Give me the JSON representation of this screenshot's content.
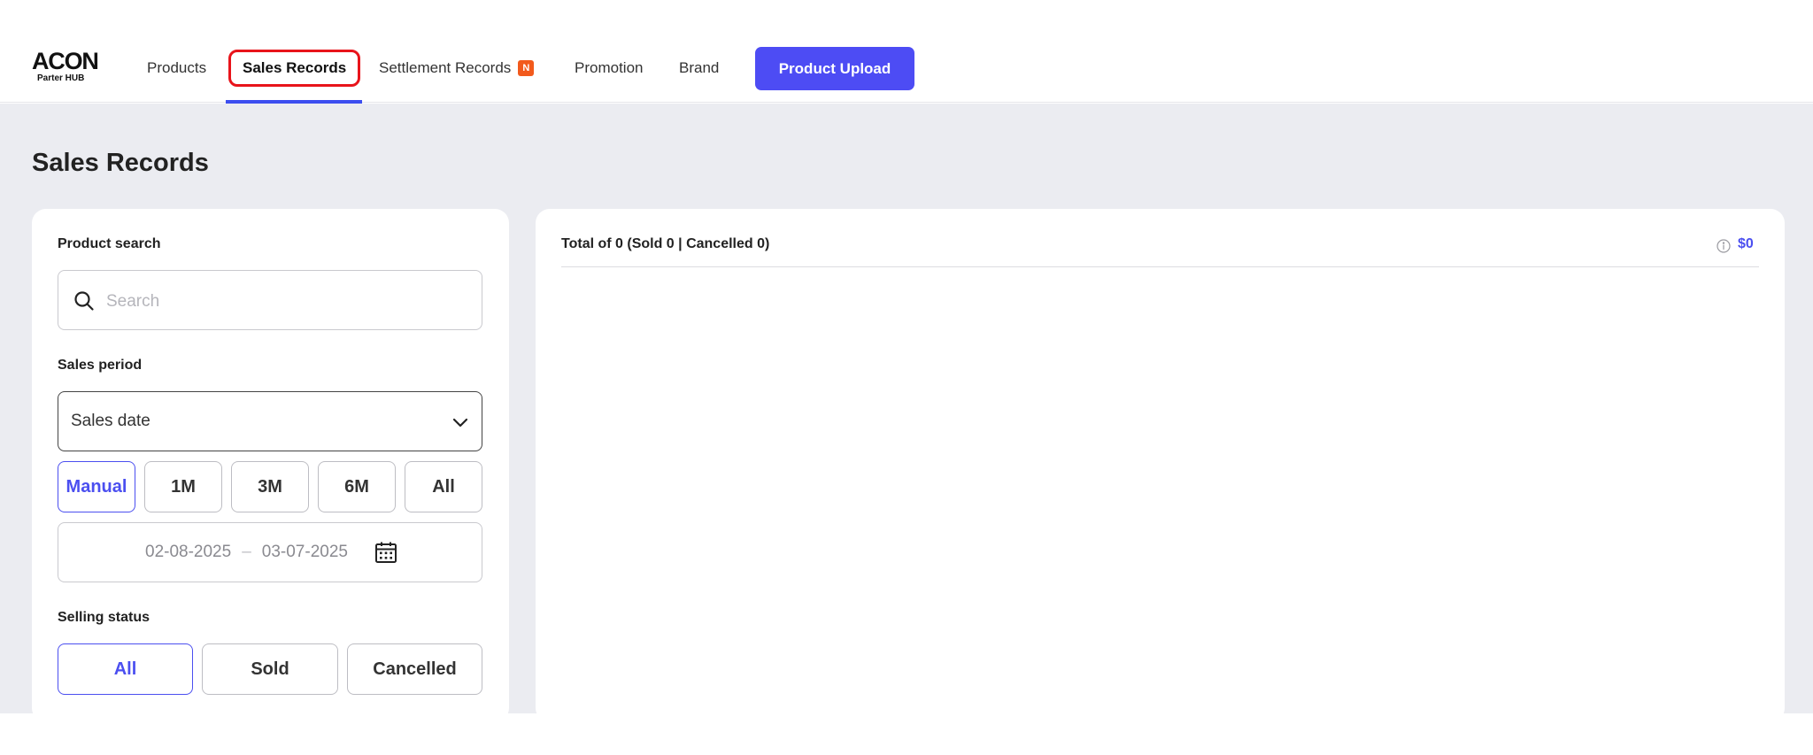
{
  "header": {
    "logo_main": "ACON",
    "logo_sub": "Parter HUB",
    "nav": {
      "products": "Products",
      "sales_records": "Sales Records",
      "settlement_records": "Settlement Records",
      "settlement_badge": "N",
      "promotion": "Promotion",
      "brand": "Brand"
    },
    "upload_button": "Product Upload"
  },
  "page_title": "Sales Records",
  "filters": {
    "product_search_label": "Product search",
    "search_placeholder": "Search",
    "sales_period_label": "Sales period",
    "sales_period_select": "Sales date",
    "period_buttons": {
      "manual": "Manual",
      "m1": "1M",
      "m3": "3M",
      "m6": "6M",
      "all": "All"
    },
    "date_from": "02-08-2025",
    "date_separator": "–",
    "date_to": "03-07-2025",
    "selling_status_label": "Selling status",
    "status_buttons": {
      "all": "All",
      "sold": "Sold",
      "cancelled": "Cancelled"
    }
  },
  "results": {
    "summary": "Total of 0 (Sold 0 | Cancelled 0)",
    "amount": "$0"
  },
  "colors": {
    "accent": "#4d4cf4",
    "highlight_border": "#e8141b",
    "badge": "#f25a1c",
    "background": "#ebecf1"
  },
  "icons": {
    "search": "search-icon",
    "dropdown": "chevron-down-icon",
    "calendar": "calendar-icon",
    "info": "info-icon"
  }
}
